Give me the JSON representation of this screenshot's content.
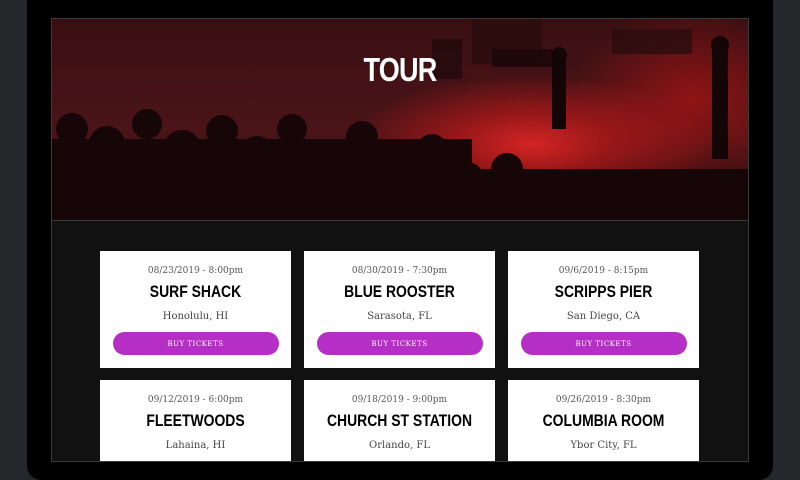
{
  "page": {
    "hero_title": "TOUR",
    "accent_color": "#b52ec5"
  },
  "events": [
    {
      "date": "08/23/2019 - 8:00pm",
      "venue": "SURF SHACK",
      "city": "Honolulu, HI",
      "button": "BUY TICKETS"
    },
    {
      "date": "08/30/2019 - 7:30pm",
      "venue": "BLUE ROOSTER",
      "city": "Sarasota, FL",
      "button": "BUY TICKETS"
    },
    {
      "date": "09/6/2019 - 8:15pm",
      "venue": "SCRIPPS PIER",
      "city": "San Diego, CA",
      "button": "BUY TICKETS"
    },
    {
      "date": "09/12/2019 - 6:00pm",
      "venue": "FLEETWOODS",
      "city": "Lahaina, HI"
    },
    {
      "date": "09/18/2019 - 9:00pm",
      "venue": "CHURCH ST STATION",
      "city": "Orlando, FL"
    },
    {
      "date": "09/26/2019 - 8:30pm",
      "venue": "COLUMBIA ROOM",
      "city": "Ybor City, FL"
    }
  ]
}
